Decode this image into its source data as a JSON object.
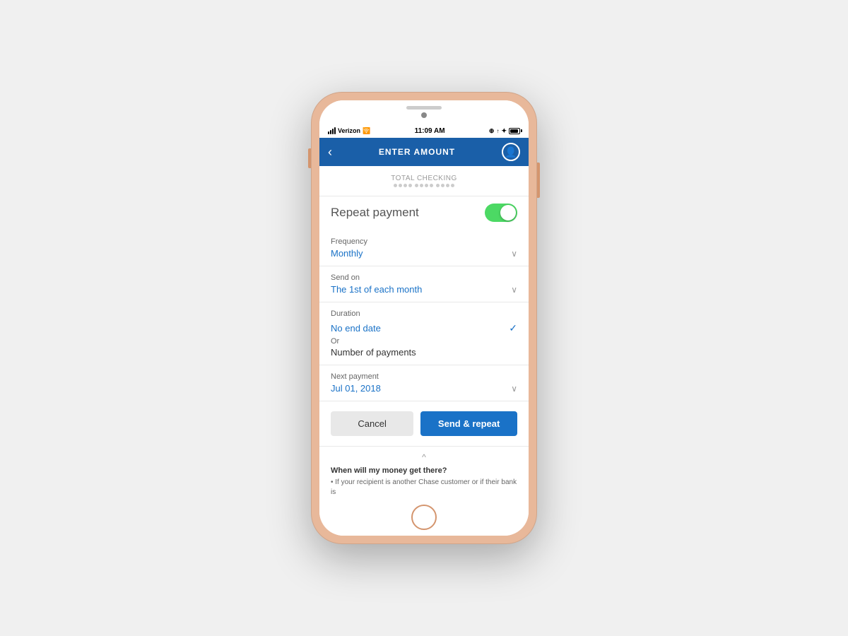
{
  "status_bar": {
    "carrier": "Verizon",
    "time": "11:09 AM"
  },
  "header": {
    "title": "ENTER AMOUNT",
    "back_label": "‹"
  },
  "account": {
    "name": "TOTAL CHECKING",
    "number_mask": "•••• •••• ••••"
  },
  "repeat_payment": {
    "label": "Repeat payment",
    "enabled": true
  },
  "frequency": {
    "label": "Frequency",
    "value": "Monthly"
  },
  "send_on": {
    "label": "Send on",
    "value": "The 1st of each month"
  },
  "duration": {
    "label": "Duration",
    "no_end_date_label": "No end date",
    "or_label": "Or",
    "number_of_payments_label": "Number of payments"
  },
  "next_payment": {
    "label": "Next payment",
    "value": "Jul 01, 2018"
  },
  "buttons": {
    "cancel": "Cancel",
    "send_repeat": "Send & repeat"
  },
  "info": {
    "toggle_label": "^",
    "title": "When will my money get there?",
    "text": "• If your recipient is another Chase customer or if their bank is"
  }
}
